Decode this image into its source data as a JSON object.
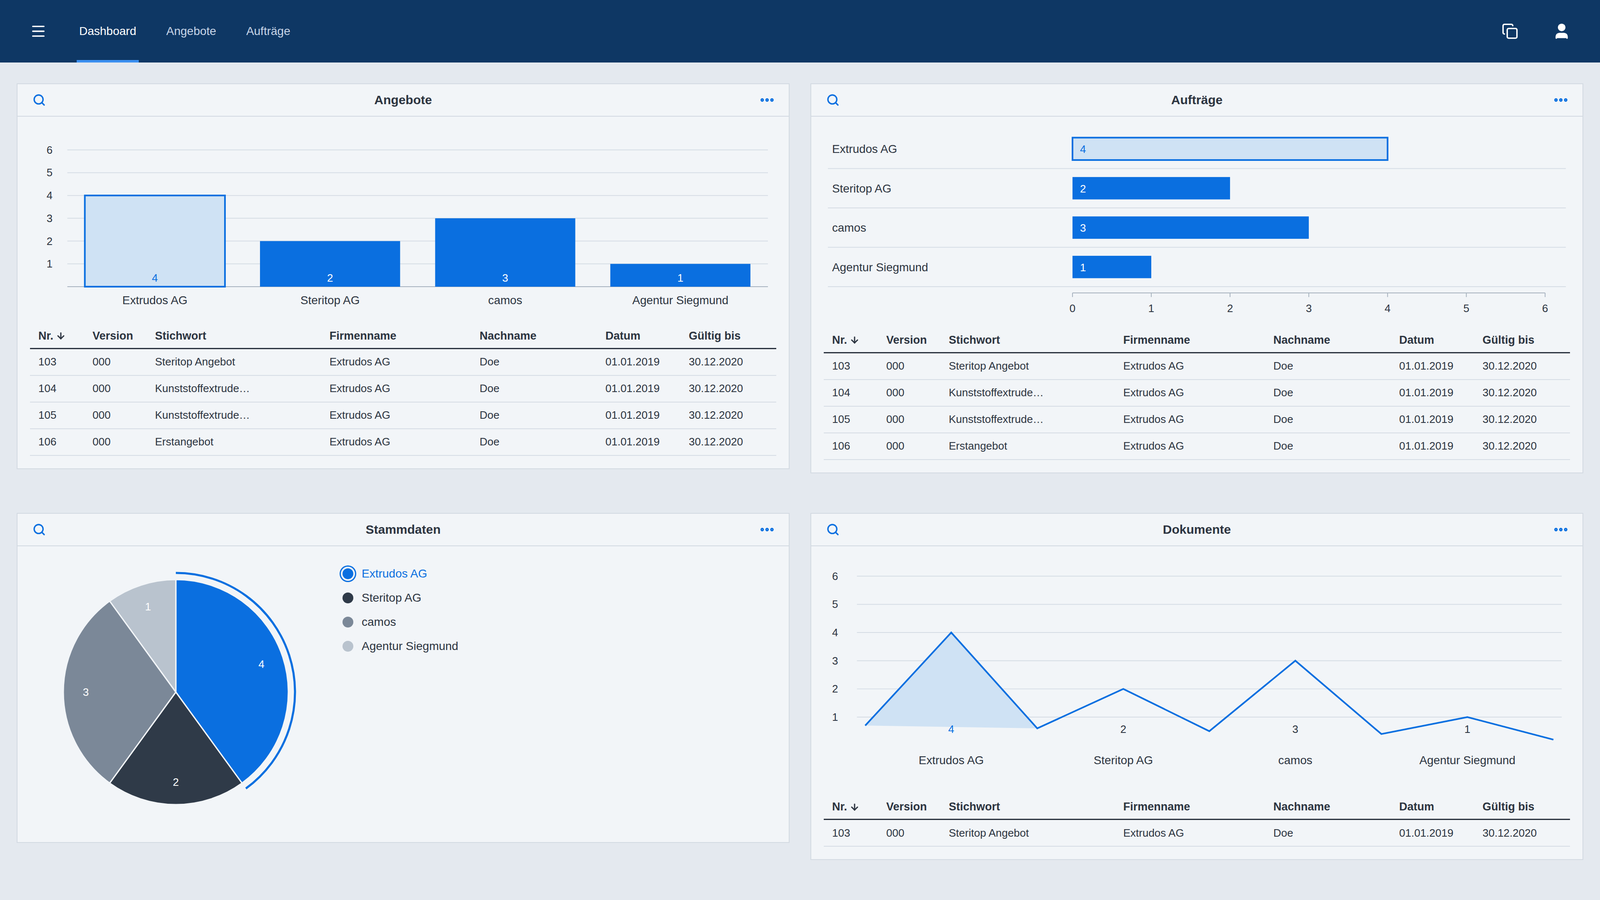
{
  "nav": {
    "tabs": [
      {
        "label": "Dashboard",
        "selected": true
      },
      {
        "label": "Angebote",
        "selected": false
      },
      {
        "label": "Aufträge",
        "selected": false
      }
    ]
  },
  "angebote": {
    "title": "Angebote",
    "chart": {
      "ticks": [
        "6",
        "5",
        "4",
        "3",
        "2",
        "1"
      ],
      "bars": [
        {
          "label": "Extrudos AG",
          "value": 4,
          "value_label": "4",
          "selected": true
        },
        {
          "label": "Steritop AG",
          "value": 2,
          "value_label": "2",
          "selected": false
        },
        {
          "label": "camos",
          "value": 3,
          "value_label": "3",
          "selected": false
        },
        {
          "label": "Agentur Siegmund",
          "value": 1,
          "value_label": "1",
          "selected": false
        }
      ]
    },
    "table": {
      "columns": [
        {
          "label": "Nr.",
          "sorted": true
        },
        {
          "label": "Version",
          "sorted": false
        },
        {
          "label": "Stichwort",
          "sorted": false
        },
        {
          "label": "Firmenname",
          "sorted": false
        },
        {
          "label": "Nachname",
          "sorted": false
        },
        {
          "label": "Datum",
          "sorted": false
        },
        {
          "label": "Gültig bis",
          "sorted": false
        }
      ],
      "rows": [
        [
          "103",
          "000",
          "Steritop Angebot",
          "Extrudos AG",
          "Doe",
          "01.01.2019",
          "30.12.2020"
        ],
        [
          "104",
          "000",
          "Kunststoffextrude…",
          "Extrudos AG",
          "Doe",
          "01.01.2019",
          "30.12.2020"
        ],
        [
          "105",
          "000",
          "Kunststoffextrude…",
          "Extrudos AG",
          "Doe",
          "01.01.2019",
          "30.12.2020"
        ],
        [
          "106",
          "000",
          "Erstangebot",
          "Extrudos AG",
          "Doe",
          "01.01.2019",
          "30.12.2020"
        ]
      ]
    }
  },
  "auftraege": {
    "title": "Aufträge",
    "chart": {
      "ticks": [
        "0",
        "1",
        "2",
        "3",
        "4",
        "5",
        "6"
      ],
      "bars": [
        {
          "label": "Extrudos AG",
          "value": 4,
          "value_label": "4",
          "selected": true
        },
        {
          "label": "Steritop AG",
          "value": 2,
          "value_label": "2",
          "selected": false
        },
        {
          "label": "camos",
          "value": 3,
          "value_label": "3",
          "selected": false
        },
        {
          "label": "Agentur Siegmund",
          "value": 1,
          "value_label": "1",
          "selected": false
        }
      ]
    },
    "table": {
      "columns": [
        {
          "label": "Nr.",
          "sorted": true
        },
        {
          "label": "Version",
          "sorted": false
        },
        {
          "label": "Stichwort",
          "sorted": false
        },
        {
          "label": "Firmenname",
          "sorted": false
        },
        {
          "label": "Nachname",
          "sorted": false
        },
        {
          "label": "Datum",
          "sorted": false
        },
        {
          "label": "Gültig bis",
          "sorted": false
        }
      ],
      "rows": [
        [
          "103",
          "000",
          "Steritop Angebot",
          "Extrudos AG",
          "Doe",
          "01.01.2019",
          "30.12.2020"
        ],
        [
          "104",
          "000",
          "Kunststoffextrude…",
          "Extrudos AG",
          "Doe",
          "01.01.2019",
          "30.12.2020"
        ],
        [
          "105",
          "000",
          "Kunststoffextrude…",
          "Extrudos AG",
          "Doe",
          "01.01.2019",
          "30.12.2020"
        ],
        [
          "106",
          "000",
          "Erstangebot",
          "Extrudos AG",
          "Doe",
          "01.01.2019",
          "30.12.2020"
        ]
      ]
    }
  },
  "stammdaten": {
    "title": "Stammdaten",
    "slices": [
      {
        "label": "Extrudos AG",
        "value": 4,
        "value_label": "4",
        "color": "#0a6fe0",
        "selected": true
      },
      {
        "label": "Steritop AG",
        "value": 2,
        "value_label": "2",
        "color": "#2f3a48",
        "selected": false
      },
      {
        "label": "camos",
        "value": 3,
        "value_label": "3",
        "color": "#7b8898",
        "selected": false
      },
      {
        "label": "Agentur Siegmund",
        "value": 1,
        "value_label": "1",
        "color": "#b9c3ce",
        "selected": false
      }
    ]
  },
  "dokumente": {
    "title": "Dokumente",
    "chart": {
      "ticks": [
        "6",
        "5",
        "4",
        "3",
        "2",
        "1"
      ],
      "points": [
        {
          "kind": "valley",
          "value": 0.7,
          "selected": false
        },
        {
          "kind": "peak",
          "value": 4,
          "value_label": "4",
          "category": "Extrudos AG",
          "selected": true
        },
        {
          "kind": "valley",
          "value": 0.6,
          "selected": false
        },
        {
          "kind": "peak",
          "value": 2,
          "value_label": "2",
          "category": "Steritop AG",
          "selected": false
        },
        {
          "kind": "valley",
          "value": 0.5,
          "selected": false
        },
        {
          "kind": "peak",
          "value": 3,
          "value_label": "3",
          "category": "camos",
          "selected": false
        },
        {
          "kind": "valley",
          "value": 0.4,
          "selected": false
        },
        {
          "kind": "peak",
          "value": 1,
          "value_label": "1",
          "category": "Agentur Siegmund",
          "selected": false
        },
        {
          "kind": "valley",
          "value": 0.2,
          "selected": false
        }
      ]
    },
    "table": {
      "columns": [
        {
          "label": "Nr.",
          "sorted": true
        },
        {
          "label": "Version",
          "sorted": false
        },
        {
          "label": "Stichwort",
          "sorted": false
        },
        {
          "label": "Firmenname",
          "sorted": false
        },
        {
          "label": "Nachname",
          "sorted": false
        },
        {
          "label": "Datum",
          "sorted": false
        },
        {
          "label": "Gültig bis",
          "sorted": false
        }
      ],
      "rows": [
        [
          "103",
          "000",
          "Steritop Angebot",
          "Extrudos AG",
          "Doe",
          "01.01.2019",
          "30.12.2020"
        ]
      ]
    }
  }
}
